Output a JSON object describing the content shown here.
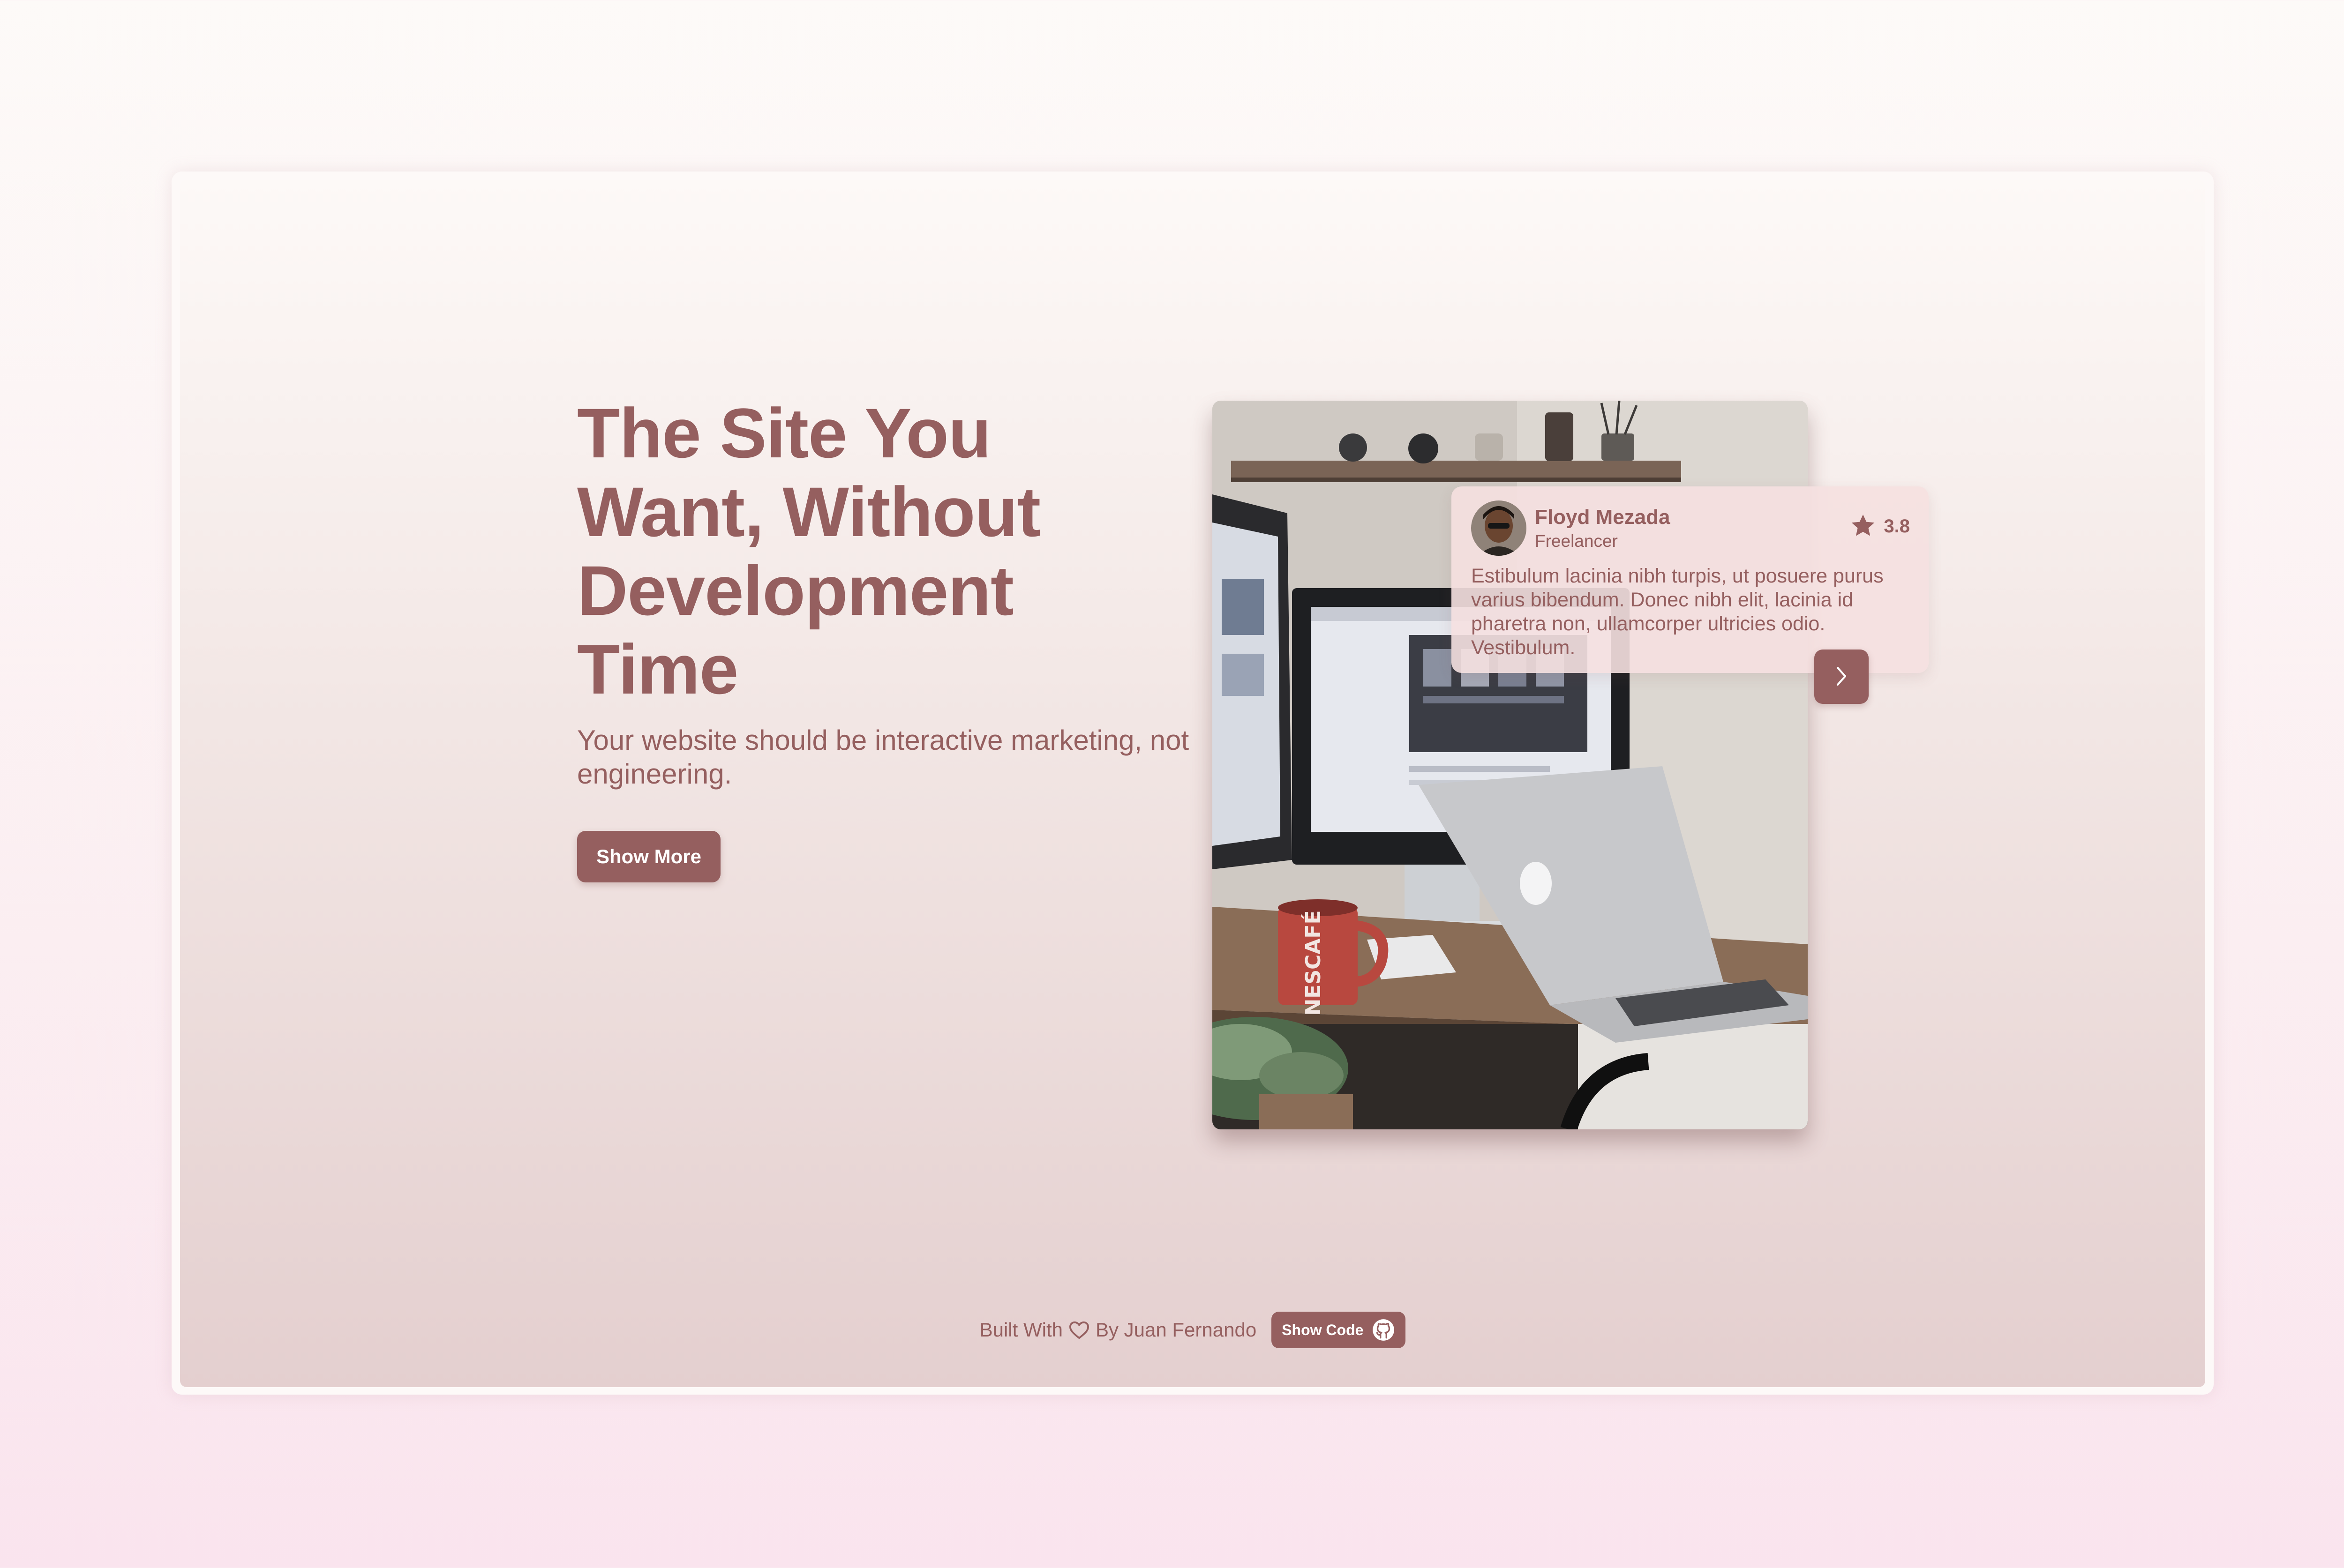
{
  "hero": {
    "headline": "The Site You Want, Without Development Time",
    "subtitle": "Your website should be interactive marketing, not engineering.",
    "cta_label": "Show More"
  },
  "photo": {
    "alt": "Desk with monitor, laptop and coffee mug",
    "mug_text": "NESCAFÉ"
  },
  "review": {
    "name": "Floyd Mezada",
    "role": "Freelancer",
    "rating": "3.8",
    "text": "Estibulum lacinia nibh turpis, ut posuere purus varius bibendum. Donec nibh elit, lacinia id pharetra non, ullamcorper ultricies odio. Vestibulum."
  },
  "footer": {
    "built_with": "Built With",
    "by": "By Juan Fernando",
    "show_code_label": "Show Code"
  },
  "icons": {
    "star": "star-icon",
    "next": "chevron-right-icon",
    "heart": "heart-icon",
    "github": "github-icon"
  },
  "colors": {
    "accent": "#955f5f",
    "card_bg": "#f5e0e0",
    "page_bg_top": "#fdfaf8",
    "page_bg_bottom": "#fae4ee"
  }
}
